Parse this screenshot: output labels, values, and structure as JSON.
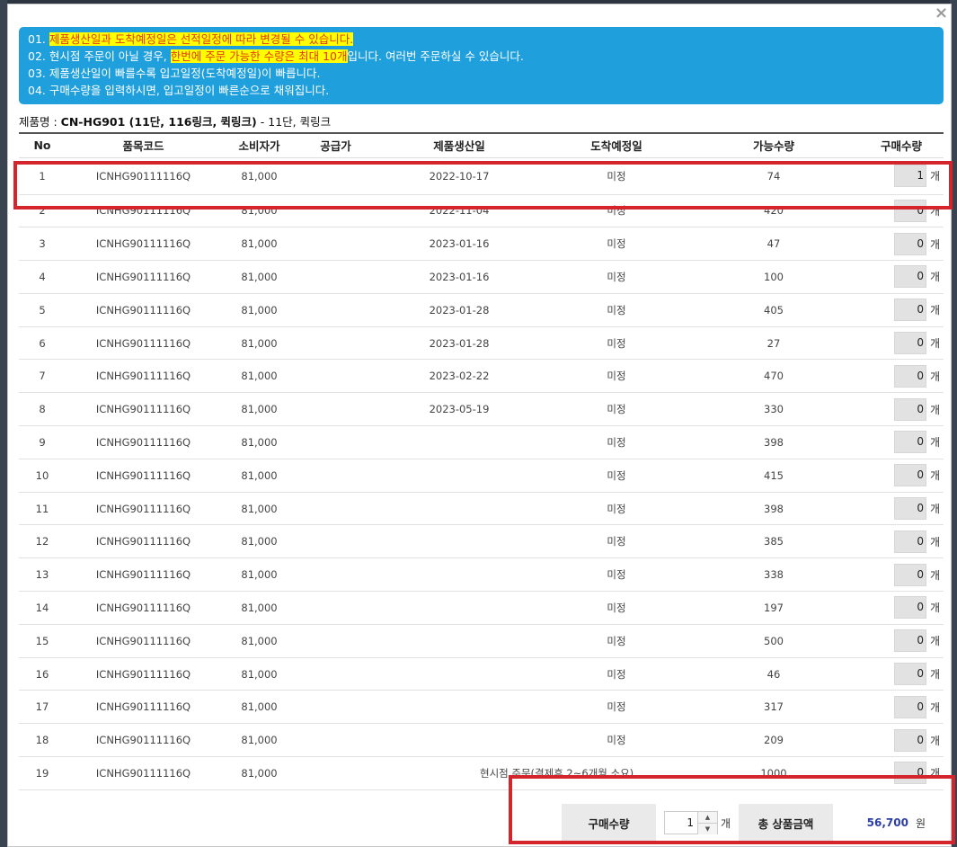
{
  "modal": {
    "close_label": "×"
  },
  "notice": {
    "line1": {
      "prefix": "01. ",
      "highlight": "제품생산일과 도착예정일은 선적일정에 따라 변경될 수 있습니다."
    },
    "line2": {
      "prefix": "02. 현시점 주문이 아닐 경우, ",
      "highlight": "한번에 주문 가능한 수량은 최대 10개",
      "suffix": "입니다. 여러번 주문하실 수 있습니다."
    },
    "line3": "03. 제품생산일이 빠를수록 입고일정(도착예정일)이 빠릅니다.",
    "line4": "04. 구매수량을 입력하시면, 입고일정이 빠른순으로 채워집니다."
  },
  "product": {
    "label": "제품명 : ",
    "name_bold": "CN-HG901 (11단, 116링크, 퀵링크)",
    "name_suffix": " - 11단, 퀵링크"
  },
  "table": {
    "headers": [
      "No",
      "품목코드",
      "소비자가",
      "공급가",
      "제품생산일",
      "도착예정일",
      "가능수량",
      "구매수량"
    ],
    "unit": "개",
    "rows": [
      {
        "no": "1",
        "code": "ICNHG90111116Q",
        "price": "81,000",
        "supply": "",
        "prod_date": "2022-10-17",
        "arrival": "미정",
        "avail": "74",
        "qty": "1"
      },
      {
        "no": "2",
        "code": "ICNHG90111116Q",
        "price": "81,000",
        "supply": "",
        "prod_date": "2022-11-04",
        "arrival": "미정",
        "avail": "420",
        "qty": "0"
      },
      {
        "no": "3",
        "code": "ICNHG90111116Q",
        "price": "81,000",
        "supply": "",
        "prod_date": "2023-01-16",
        "arrival": "미정",
        "avail": "47",
        "qty": "0"
      },
      {
        "no": "4",
        "code": "ICNHG90111116Q",
        "price": "81,000",
        "supply": "",
        "prod_date": "2023-01-16",
        "arrival": "미정",
        "avail": "100",
        "qty": "0"
      },
      {
        "no": "5",
        "code": "ICNHG90111116Q",
        "price": "81,000",
        "supply": "",
        "prod_date": "2023-01-28",
        "arrival": "미정",
        "avail": "405",
        "qty": "0"
      },
      {
        "no": "6",
        "code": "ICNHG90111116Q",
        "price": "81,000",
        "supply": "",
        "prod_date": "2023-01-28",
        "arrival": "미정",
        "avail": "27",
        "qty": "0"
      },
      {
        "no": "7",
        "code": "ICNHG90111116Q",
        "price": "81,000",
        "supply": "",
        "prod_date": "2023-02-22",
        "arrival": "미정",
        "avail": "470",
        "qty": "0"
      },
      {
        "no": "8",
        "code": "ICNHG90111116Q",
        "price": "81,000",
        "supply": "",
        "prod_date": "2023-05-19",
        "arrival": "미정",
        "avail": "330",
        "qty": "0"
      },
      {
        "no": "9",
        "code": "ICNHG90111116Q",
        "price": "81,000",
        "supply": "",
        "prod_date": "",
        "arrival": "미정",
        "avail": "398",
        "qty": "0"
      },
      {
        "no": "10",
        "code": "ICNHG90111116Q",
        "price": "81,000",
        "supply": "",
        "prod_date": "",
        "arrival": "미정",
        "avail": "415",
        "qty": "0"
      },
      {
        "no": "11",
        "code": "ICNHG90111116Q",
        "price": "81,000",
        "supply": "",
        "prod_date": "",
        "arrival": "미정",
        "avail": "398",
        "qty": "0"
      },
      {
        "no": "12",
        "code": "ICNHG90111116Q",
        "price": "81,000",
        "supply": "",
        "prod_date": "",
        "arrival": "미정",
        "avail": "385",
        "qty": "0"
      },
      {
        "no": "13",
        "code": "ICNHG90111116Q",
        "price": "81,000",
        "supply": "",
        "prod_date": "",
        "arrival": "미정",
        "avail": "338",
        "qty": "0"
      },
      {
        "no": "14",
        "code": "ICNHG90111116Q",
        "price": "81,000",
        "supply": "",
        "prod_date": "",
        "arrival": "미정",
        "avail": "197",
        "qty": "0"
      },
      {
        "no": "15",
        "code": "ICNHG90111116Q",
        "price": "81,000",
        "supply": "",
        "prod_date": "",
        "arrival": "미정",
        "avail": "500",
        "qty": "0"
      },
      {
        "no": "16",
        "code": "ICNHG90111116Q",
        "price": "81,000",
        "supply": "",
        "prod_date": "",
        "arrival": "미정",
        "avail": "46",
        "qty": "0"
      },
      {
        "no": "17",
        "code": "ICNHG90111116Q",
        "price": "81,000",
        "supply": "",
        "prod_date": "",
        "arrival": "미정",
        "avail": "317",
        "qty": "0"
      },
      {
        "no": "18",
        "code": "ICNHG90111116Q",
        "price": "81,000",
        "supply": "",
        "prod_date": "",
        "arrival": "미정",
        "avail": "209",
        "qty": "0"
      },
      {
        "no": "19",
        "code": "ICNHG90111116Q",
        "price": "81,000",
        "supply": "",
        "note": "현시점 주문(결제후 2~6개월 소요)",
        "avail": "1000",
        "qty": "0"
      }
    ]
  },
  "summary": {
    "qty_label": "구매수량",
    "qty_value": "1",
    "qty_unit": "개",
    "total_label": "총 상품금액",
    "total_value": "56,700",
    "total_unit": "원"
  },
  "colors": {
    "notice_bg": "#1fa0dc",
    "highlight": "#ffff00",
    "highlight_text": "#e03a10",
    "annotation_frame": "#d4242c",
    "total_value": "#2a3fa0"
  },
  "icons": {
    "spin_up": "▲",
    "spin_down": "▼"
  }
}
